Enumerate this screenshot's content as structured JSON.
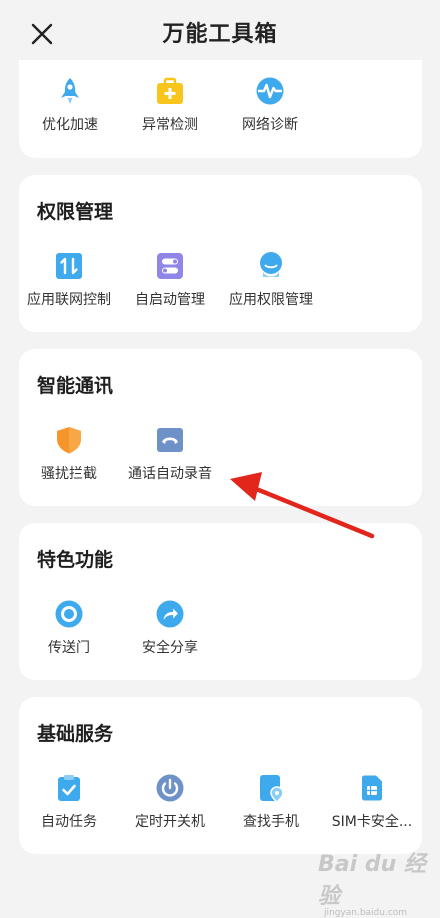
{
  "header": {
    "title": "万能工具箱"
  },
  "sections": {
    "top": {
      "items": [
        {
          "label": "优化加速",
          "icon": "rocket-icon"
        },
        {
          "label": "异常检测",
          "icon": "first-aid-kit-icon"
        },
        {
          "label": "网络诊断",
          "icon": "network-pulse-icon"
        }
      ]
    },
    "permission": {
      "title": "权限管理",
      "items": [
        {
          "label": "应用联网控制",
          "icon": "network-toggle-icon"
        },
        {
          "label": "自启动管理",
          "icon": "switch-icon"
        },
        {
          "label": "应用权限管理",
          "icon": "shield-person-icon"
        }
      ]
    },
    "comm": {
      "title": "智能通讯",
      "items": [
        {
          "label": "骚扰拦截",
          "icon": "shield-icon"
        },
        {
          "label": "通话自动录音",
          "icon": "phone-record-icon"
        }
      ]
    },
    "feature": {
      "title": "特色功能",
      "items": [
        {
          "label": "传送门",
          "icon": "portal-icon"
        },
        {
          "label": "安全分享",
          "icon": "share-icon"
        }
      ]
    },
    "basic": {
      "title": "基础服务",
      "items": [
        {
          "label": "自动任务",
          "icon": "clipboard-check-icon"
        },
        {
          "label": "定时开关机",
          "icon": "power-icon"
        },
        {
          "label": "查找手机",
          "icon": "find-phone-icon"
        },
        {
          "label": "SIM卡安全...",
          "icon": "sim-card-icon"
        }
      ]
    }
  },
  "watermark": {
    "text": "Bai du 经验",
    "sub": "jingyan.baidu.com"
  },
  "colors": {
    "blue": "#3fa9ee",
    "yellow": "#f7c51b",
    "orange": "#f7952b",
    "purple": "#8f86e8",
    "steel": "#6e91c7"
  }
}
